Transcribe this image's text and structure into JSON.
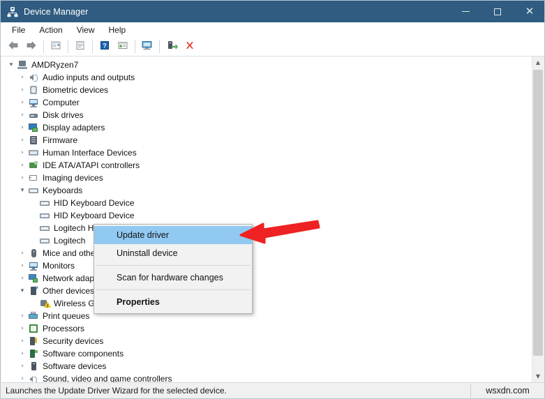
{
  "window": {
    "title": "Device Manager",
    "icon": "device-manager-icon",
    "controls": {
      "minimize": "–",
      "maximize": "□",
      "close": "✕"
    },
    "titlebar_color": "#2f5c80"
  },
  "menubar": {
    "items": [
      {
        "label": "File"
      },
      {
        "label": "Action"
      },
      {
        "label": "View"
      },
      {
        "label": "Help"
      }
    ]
  },
  "toolbar": {
    "buttons": [
      {
        "name": "back-icon"
      },
      {
        "name": "forward-icon"
      },
      {
        "name": "show-hide-console-tree-icon"
      },
      {
        "name": "properties-icon"
      },
      {
        "name": "help-icon"
      },
      {
        "name": "update-driver-icon"
      },
      {
        "name": "scan-hardware-changes-icon"
      },
      {
        "name": "enable-device-icon"
      },
      {
        "name": "uninstall-device-icon"
      }
    ]
  },
  "tree": {
    "nodes": [
      {
        "label": "AMDRyzen7",
        "depth": 0,
        "state": "expanded",
        "icon": "computer-root-icon"
      },
      {
        "label": "Audio inputs and outputs",
        "depth": 1,
        "state": "collapsed",
        "icon": "audio-icon"
      },
      {
        "label": "Biometric devices",
        "depth": 1,
        "state": "collapsed",
        "icon": "biometric-icon"
      },
      {
        "label": "Computer",
        "depth": 1,
        "state": "collapsed",
        "icon": "computer-icon"
      },
      {
        "label": "Disk drives",
        "depth": 1,
        "state": "collapsed",
        "icon": "disk-icon"
      },
      {
        "label": "Display adapters",
        "depth": 1,
        "state": "collapsed",
        "icon": "display-adapter-icon"
      },
      {
        "label": "Firmware",
        "depth": 1,
        "state": "collapsed",
        "icon": "firmware-icon"
      },
      {
        "label": "Human Interface Devices",
        "depth": 1,
        "state": "collapsed",
        "icon": "hid-icon"
      },
      {
        "label": "IDE ATA/ATAPI controllers",
        "depth": 1,
        "state": "collapsed",
        "icon": "ide-controller-icon"
      },
      {
        "label": "Imaging devices",
        "depth": 1,
        "state": "collapsed",
        "icon": "imaging-icon"
      },
      {
        "label": "Keyboards",
        "depth": 1,
        "state": "expanded",
        "icon": "keyboard-icon"
      },
      {
        "label": "HID Keyboard Device",
        "depth": 2,
        "state": "leaf",
        "icon": "keyboard-icon"
      },
      {
        "label": "HID Keyboard Device",
        "depth": 2,
        "state": "leaf",
        "icon": "keyboard-icon"
      },
      {
        "label": "Logitech HID-compliant Unifying keyboard",
        "depth": 2,
        "state": "leaf",
        "icon": "keyboard-icon"
      },
      {
        "label": "Logitech",
        "depth": 2,
        "state": "leaf",
        "icon": "keyboard-icon"
      },
      {
        "label": "Mice and other pointing devices",
        "depth": 1,
        "state": "collapsed",
        "icon": "mouse-icon"
      },
      {
        "label": "Monitors",
        "depth": 1,
        "state": "collapsed",
        "icon": "monitor-icon"
      },
      {
        "label": "Network adapters",
        "depth": 1,
        "state": "collapsed",
        "icon": "network-adapter-icon"
      },
      {
        "label": "Other devices",
        "depth": 1,
        "state": "expanded",
        "icon": "other-devices-icon"
      },
      {
        "label": "Wireless Gamepad F710",
        "depth": 2,
        "state": "leaf",
        "icon": "gamepad-warning-icon"
      },
      {
        "label": "Print queues",
        "depth": 1,
        "state": "collapsed",
        "icon": "print-queue-icon"
      },
      {
        "label": "Processors",
        "depth": 1,
        "state": "collapsed",
        "icon": "processor-icon"
      },
      {
        "label": "Security devices",
        "depth": 1,
        "state": "collapsed",
        "icon": "security-device-icon"
      },
      {
        "label": "Software components",
        "depth": 1,
        "state": "collapsed",
        "icon": "software-component-icon"
      },
      {
        "label": "Software devices",
        "depth": 1,
        "state": "collapsed",
        "icon": "software-device-icon"
      },
      {
        "label": "Sound, video and game controllers",
        "depth": 1,
        "state": "collapsed",
        "icon": "sound-icon"
      }
    ],
    "expander_expanded": "⌄",
    "expander_collapsed": "›"
  },
  "context_menu": {
    "items": [
      {
        "label": "Update driver",
        "highlighted": true,
        "bold": false,
        "separator_after": false
      },
      {
        "label": "Uninstall device",
        "highlighted": false,
        "bold": false,
        "separator_after": true
      },
      {
        "label": "Scan for hardware changes",
        "highlighted": false,
        "bold": false,
        "separator_after": true
      },
      {
        "label": "Properties",
        "highlighted": false,
        "bold": true,
        "separator_after": false
      }
    ],
    "highlight_color": "#91c9f2"
  },
  "annotation": {
    "arrow_color": "#ee2222",
    "points_to": "Update driver"
  },
  "statusbar": {
    "message": "Launches the Update Driver Wizard for the selected device.",
    "watermark": "wsxdn.com"
  },
  "scrollbar": {
    "up_arrow": "⌃",
    "down_arrow": "⌄"
  }
}
